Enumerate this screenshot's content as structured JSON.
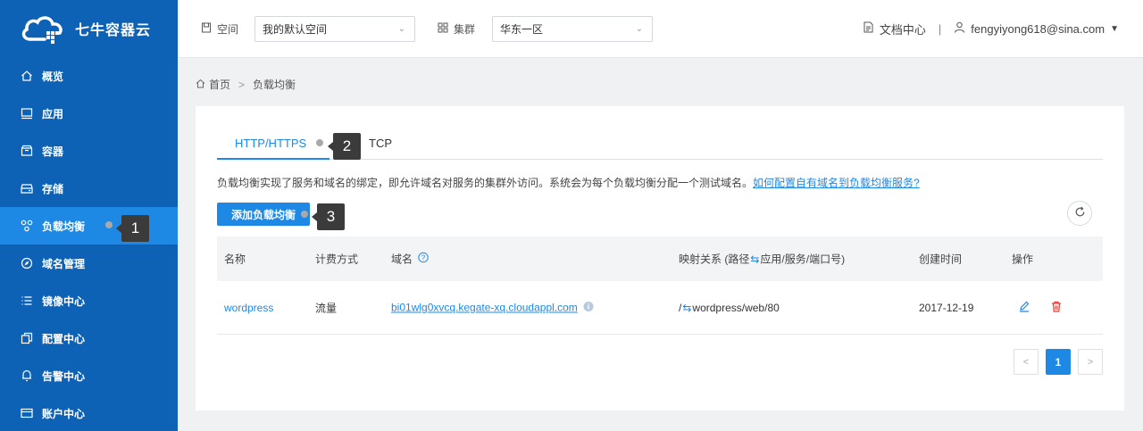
{
  "brand": {
    "name": "七牛容器云"
  },
  "sidebar": {
    "items": [
      {
        "label": "概览",
        "icon": "home-icon",
        "active": false
      },
      {
        "label": "应用",
        "icon": "monitor-icon",
        "active": false
      },
      {
        "label": "容器",
        "icon": "box-icon",
        "active": false
      },
      {
        "label": "存储",
        "icon": "storage-icon",
        "active": false
      },
      {
        "label": "负载均衡",
        "icon": "load-balancer-icon",
        "active": true
      },
      {
        "label": "域名管理",
        "icon": "compass-icon",
        "active": false
      },
      {
        "label": "镜像中心",
        "icon": "list-icon",
        "active": false
      },
      {
        "label": "配置中心",
        "icon": "copy-icon",
        "active": false
      },
      {
        "label": "告警中心",
        "icon": "bell-icon",
        "active": false
      },
      {
        "label": "账户中心",
        "icon": "card-icon",
        "active": false
      }
    ]
  },
  "topbar": {
    "space_label": "空间",
    "space_value": "我的默认空间",
    "cluster_label": "集群",
    "cluster_value": "华东一区",
    "docs_label": "文档中心",
    "separator": "|",
    "user": "fengyiyong618@sina.com"
  },
  "breadcrumb": {
    "home": "首页",
    "sep": ">",
    "current": "负载均衡"
  },
  "tabs": [
    {
      "label": "HTTP/HTTPS",
      "active": true
    },
    {
      "label": "TCP",
      "active": false
    }
  ],
  "description": {
    "text": "负载均衡实现了服务和域名的绑定，即允许域名对服务的集群外访问。系统会为每个负载均衡分配一个测试域名。",
    "link": "如何配置自有域名到负载均衡服务?"
  },
  "add_button": "添加负载均衡",
  "table": {
    "headers": {
      "name": "名称",
      "billing": "计费方式",
      "domain": "域名",
      "mapping_prefix": "映射关系 (路径",
      "mapping_arrow": "⇆",
      "mapping_suffix": "应用/服务/端口号)",
      "created": "创建时间",
      "actions": "操作"
    },
    "rows": [
      {
        "name": "wordpress",
        "billing": "流量",
        "domain": "bi01wlg0xvcq.kegate-xq.cloudappl.com",
        "mapping_path": "/",
        "mapping_arrow": "⇆",
        "mapping_target": "wordpress/web/80",
        "created": "2017-12-19"
      }
    ]
  },
  "pagination": {
    "prev": "<",
    "current": "1",
    "next": ">"
  },
  "callouts": [
    "1",
    "2",
    "3"
  ],
  "colors": {
    "sidebar": "#0d62b5",
    "sidebar_active": "#1e88e5",
    "accent": "#1e88e5",
    "danger": "#e53935"
  }
}
